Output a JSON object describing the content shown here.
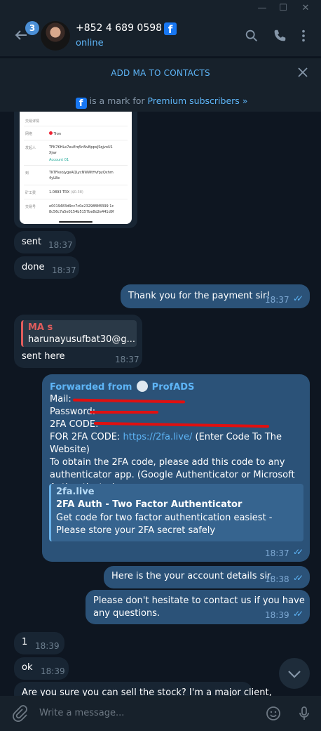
{
  "window": {
    "minimize": "—",
    "maximize": "☐",
    "close": "✕"
  },
  "header": {
    "back_badge": "3",
    "contact_name": "+852 4 689 0598",
    "facebook_mark": "f",
    "status": "online"
  },
  "contact_bar": {
    "label": "ADD MA TO CONTACTS"
  },
  "premium_bar": {
    "text": "is a mark for",
    "link": "Premium subscribers »"
  },
  "receipt_image": {
    "heading": "交易详情",
    "network_label": "网络",
    "network_value": "Tron",
    "sender_label": "发起人",
    "sender_value_1": "TFK7KHLe7euErq5nNvBppxJSqjvoU1",
    "sender_value_2": "Xjwr",
    "sender_account": "Account 01",
    "to_label": "到",
    "to_value_1": "TKTFkeojygeAQLycNWWtHvfpyQxhm",
    "to_value_2": "4yL8e",
    "fee_label": "矿工费",
    "fee_value": "1.0893 TRX",
    "fee_usd": "($0.38)",
    "tx_label": "交易号",
    "tx_value_1": "e0019483d9cc7c0e23298f8f8399 1c",
    "tx_value_2": "8c56c7a5e0154b5157be8d2e441d9f"
  },
  "messages": [
    {
      "id": "sent",
      "text": "sent",
      "time": "18:37"
    },
    {
      "id": "done",
      "text": "done",
      "time": "18:37"
    },
    {
      "id": "thanks",
      "text": "Thank you for the payment sir!",
      "time": "18:37"
    },
    {
      "id": "sent-here",
      "reply_author": "MA s",
      "reply_text": "harunayusufbat30@g...",
      "text": "sent here",
      "time": "18:37"
    },
    {
      "id": "forwarded",
      "forwarded_prefix": "Forwarded from",
      "forwarded_source": "ProfADS",
      "line_mail": "Mail:",
      "line_password": "Password:",
      "line_2fa": "2FA CODE:",
      "line_for_2fa": "FOR 2FA CODE:",
      "link": "https://2fa.live/",
      "line_for_2fa_suffix": "(Enter Code To The Website)",
      "body": "To obtain the 2FA code, please add this code to any authenticator app. (Google Authenticator or Microsoft Authenticator)",
      "preview_site": "2fa.live",
      "preview_title": "2FA Auth - Two Factor Authenticator",
      "preview_desc": "Get code for two factor authentication easiest - Please store your 2FA secret safely",
      "time": "18:37"
    },
    {
      "id": "details",
      "text": "Here is the your account details sir.",
      "time": "18:38"
    },
    {
      "id": "dont-hesitate",
      "text": "Please don't hesitate to contact us if you have any questions.",
      "time": "18:39"
    },
    {
      "id": "one",
      "text": "1",
      "time": "18:39"
    },
    {
      "id": "ok",
      "text": "ok",
      "time": "18:39"
    },
    {
      "id": "sure",
      "text": "Are you sure you can sell the stock? I'm a major client,"
    }
  ],
  "input": {
    "placeholder": "Write a message..."
  },
  "colors": {
    "incoming": "#182533",
    "outgoing": "#2b5278",
    "accent": "#5eb5f7",
    "background": "#0e1621",
    "redaction": "#e01010"
  },
  "icons": [
    "back-arrow-icon",
    "facebook-icon",
    "search-icon",
    "phone-icon",
    "more-vertical-icon",
    "close-icon",
    "double-check-icon",
    "chevron-down-icon",
    "paperclip-icon",
    "emoji-icon",
    "microphone-icon"
  ]
}
